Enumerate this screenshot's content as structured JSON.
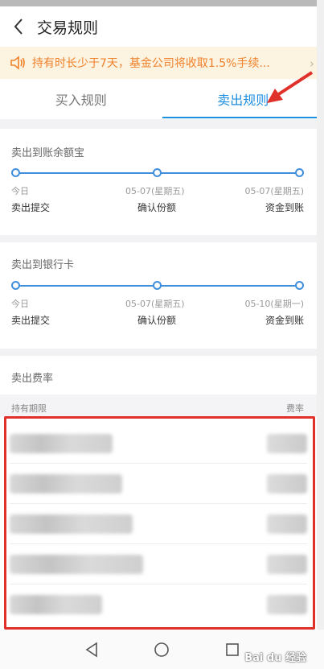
{
  "header": {
    "title": "交易规则"
  },
  "notice": {
    "text": "持有时长少于7天，基金公司将收取1.5%手续..."
  },
  "tabs": [
    {
      "label": "买入规则",
      "active": false
    },
    {
      "label": "卖出规则",
      "active": true
    }
  ],
  "sections": [
    {
      "title": "卖出到账余额宝",
      "steps": [
        {
          "date": "今日",
          "label": "卖出提交"
        },
        {
          "date": "05-07(星期五)",
          "label": "确认份额"
        },
        {
          "date": "05-07(星期五)",
          "label": "资金到账"
        }
      ]
    },
    {
      "title": "卖出到银行卡",
      "steps": [
        {
          "date": "今日",
          "label": "卖出提交"
        },
        {
          "date": "05-07(星期五)",
          "label": "确认份额"
        },
        {
          "date": "05-10(星期一)",
          "label": "资金到账"
        }
      ]
    }
  ],
  "fee": {
    "title": "卖出费率",
    "col_period": "持有期限",
    "col_rate": "费率"
  },
  "watermark": "Bai du 经验",
  "colors": {
    "accent": "#1f8fe0",
    "notice": "#f0812a",
    "annotation": "#e0302a"
  }
}
